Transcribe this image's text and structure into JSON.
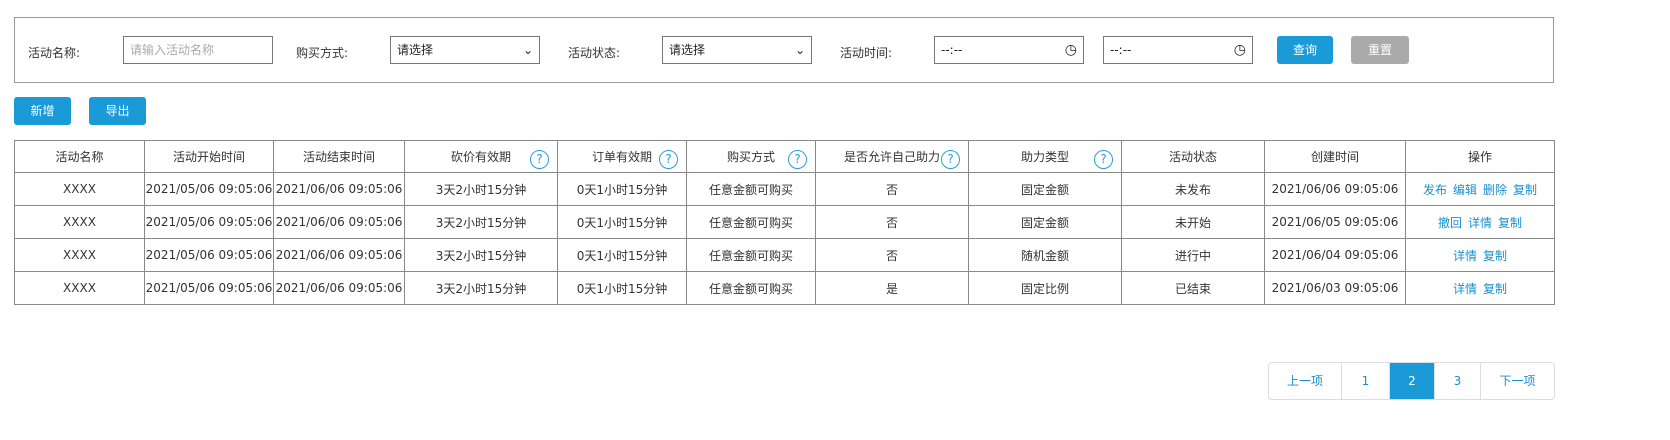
{
  "filters": {
    "name_label": "活动名称:",
    "name_placeholder": "请输入活动名称",
    "buy_label": "购买方式:",
    "buy_value": "请选择",
    "status_label": "活动状态:",
    "status_value": "请选择",
    "time_label": "活动时间:",
    "time_start": "--:--",
    "time_end": "--:--",
    "query": "查询",
    "reset": "重置"
  },
  "toolbar": {
    "add": "新增",
    "export": "导出"
  },
  "table": {
    "headers": [
      "活动名称",
      "活动开始时间",
      "活动结束时间",
      "砍价有效期",
      "订单有效期",
      "购买方式",
      "是否允许自己助力",
      "助力类型",
      "活动状态",
      "创建时间",
      "操作"
    ],
    "rows": [
      [
        "XXXX",
        "2021/05/06 09:05:06",
        "2021/06/06 09:05:06",
        "3天2小时15分钟",
        "0天1小时15分钟",
        "任意金额可购买",
        "否",
        "固定金额",
        "未发布",
        "2021/06/06 09:05:06"
      ],
      [
        "XXXX",
        "2021/05/06 09:05:06",
        "2021/06/06 09:05:06",
        "3天2小时15分钟",
        "0天1小时15分钟",
        "任意金额可购买",
        "否",
        "固定金额",
        "未开始",
        "2021/06/05 09:05:06"
      ],
      [
        "XXXX",
        "2021/05/06 09:05:06",
        "2021/06/06 09:05:06",
        "3天2小时15分钟",
        "0天1小时15分钟",
        "任意金额可购买",
        "否",
        "随机金额",
        "进行中",
        "2021/06/04 09:05:06"
      ],
      [
        "XXXX",
        "2021/05/06 09:05:06",
        "2021/06/06 09:05:06",
        "3天2小时15分钟",
        "0天1小时15分钟",
        "任意金额可购买",
        "是",
        "固定比例",
        "已结束",
        "2021/06/03 09:05:06"
      ]
    ],
    "actions": [
      [
        "发布",
        "编辑",
        "删除",
        "复制"
      ],
      [
        "撤回",
        "详情",
        "复制"
      ],
      [
        "详情",
        "复制"
      ],
      [
        "详情",
        "复制"
      ]
    ],
    "help": "?"
  },
  "pagination": {
    "prev": "上一项",
    "pages": [
      "1",
      "2",
      "3"
    ],
    "current": "2",
    "next": "下一项"
  }
}
